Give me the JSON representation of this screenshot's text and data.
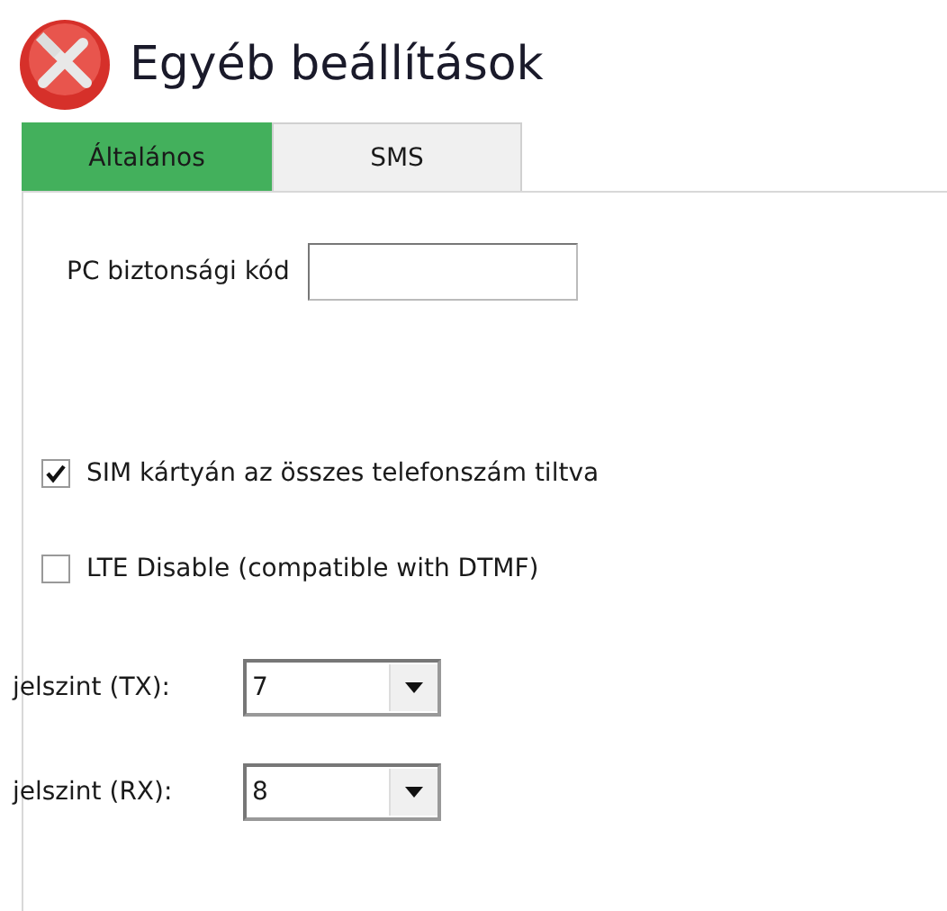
{
  "window": {
    "title": "Egyéb beállítások"
  },
  "tabs": [
    {
      "label": "Általános",
      "selected": true
    },
    {
      "label": "SMS",
      "selected": false
    }
  ],
  "pc_code": {
    "label": "PC biztonsági kód"
  },
  "checkboxes": [
    {
      "label": "SIM kártyán az összes telefonszám tiltva",
      "checked": true
    },
    {
      "label": "LTE Disable (compatible with DTMF)",
      "checked": false
    }
  ],
  "combos": [
    {
      "label": "jelszint (TX):",
      "value": "7"
    },
    {
      "label": "jelszint (RX):",
      "value": "8"
    }
  ]
}
